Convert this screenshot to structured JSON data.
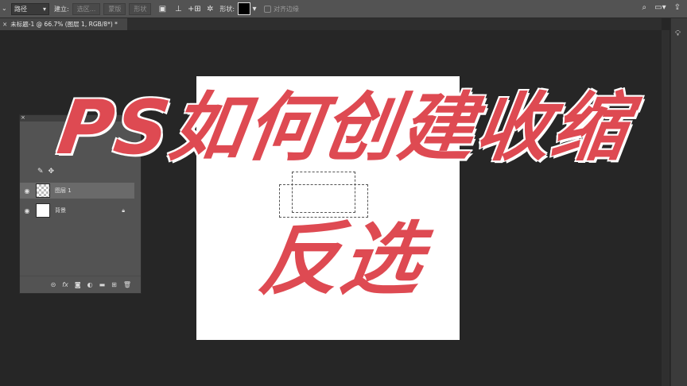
{
  "options_bar": {
    "path_mode": "路径",
    "make_label": "建立:",
    "selection_button": "选区...",
    "mask_button": "蒙版",
    "shape_button": "形状",
    "shape_label": "形状:",
    "align_edges_label": "对齐边缘"
  },
  "document_tab": {
    "title": "未标题-1 @ 66.7% (图层 1, RGB/8*) *"
  },
  "layers_panel": {
    "layers": [
      {
        "name": "图层 1",
        "selected": true,
        "locked": false
      },
      {
        "name": "背景",
        "selected": false,
        "locked": true
      }
    ]
  },
  "overlay": {
    "line1": "PS如何创建收缩",
    "line2": "反选",
    "color": "#de4a52"
  }
}
